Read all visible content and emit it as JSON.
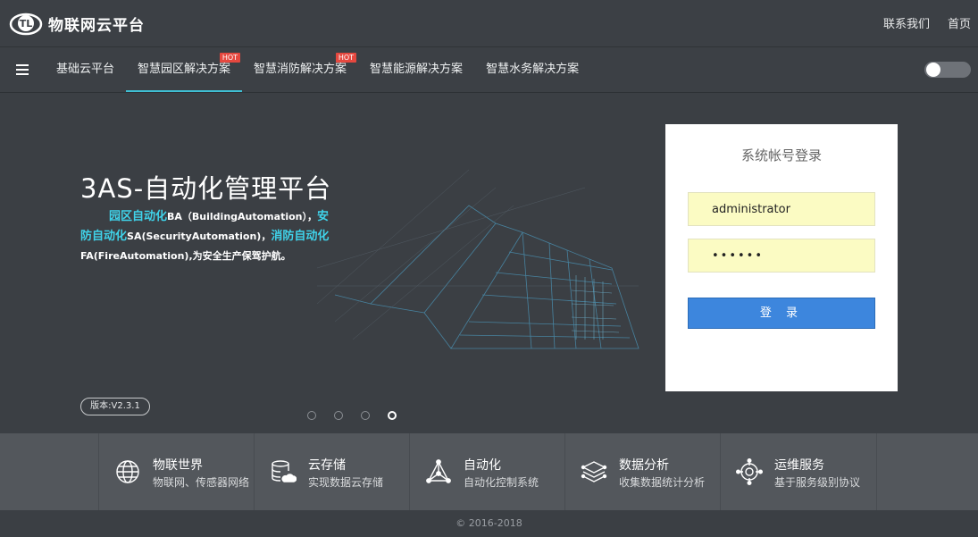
{
  "header": {
    "title": "物联网云平台",
    "links": [
      "联系我们",
      "首页"
    ]
  },
  "nav": {
    "items": [
      {
        "label": "基础云平台",
        "hot": ""
      },
      {
        "label": "智慧园区解决方案",
        "hot": "HOT"
      },
      {
        "label": "智慧消防解决方案",
        "hot": "HOT"
      },
      {
        "label": "智慧能源解决方案",
        "hot": ""
      },
      {
        "label": "智慧水务解决方案",
        "hot": ""
      }
    ],
    "active_index": 1,
    "toggle_on": false
  },
  "hero": {
    "title": "3AS-自动化管理平台",
    "desc": {
      "p1": "园区自动化",
      "p2": "BA（BuildingAutomation），",
      "p3": "安防自动化",
      "p4": "SA(SecurityAutomation)，",
      "p5": "消防自动化",
      "p6": "FA(FireAutomation),为安全生产保驾护航。"
    },
    "version": "版本:V2.3.1",
    "slide_count": 4,
    "active_slide": 3
  },
  "login": {
    "title": "系统帐号登录",
    "username": "administrator",
    "password": "••••••",
    "button": "登 录"
  },
  "features": [
    {
      "title": "物联世界",
      "subtitle": "物联网、传感器网络",
      "icon": "globe-icon"
    },
    {
      "title": "云存储",
      "subtitle": "实现数据云存储",
      "icon": "database-cloud-icon"
    },
    {
      "title": "自动化",
      "subtitle": "自动化控制系统",
      "icon": "network-triangle-icon"
    },
    {
      "title": "数据分析",
      "subtitle": "收集数据统计分析",
      "icon": "layers-icon"
    },
    {
      "title": "运维服务",
      "subtitle": "基于服务级别协议",
      "icon": "target-icon"
    }
  ],
  "footer": "© 2016-2018",
  "colors": {
    "accent": "#3fd3ea",
    "button": "#3d86dd",
    "hot": "#e5483f"
  }
}
